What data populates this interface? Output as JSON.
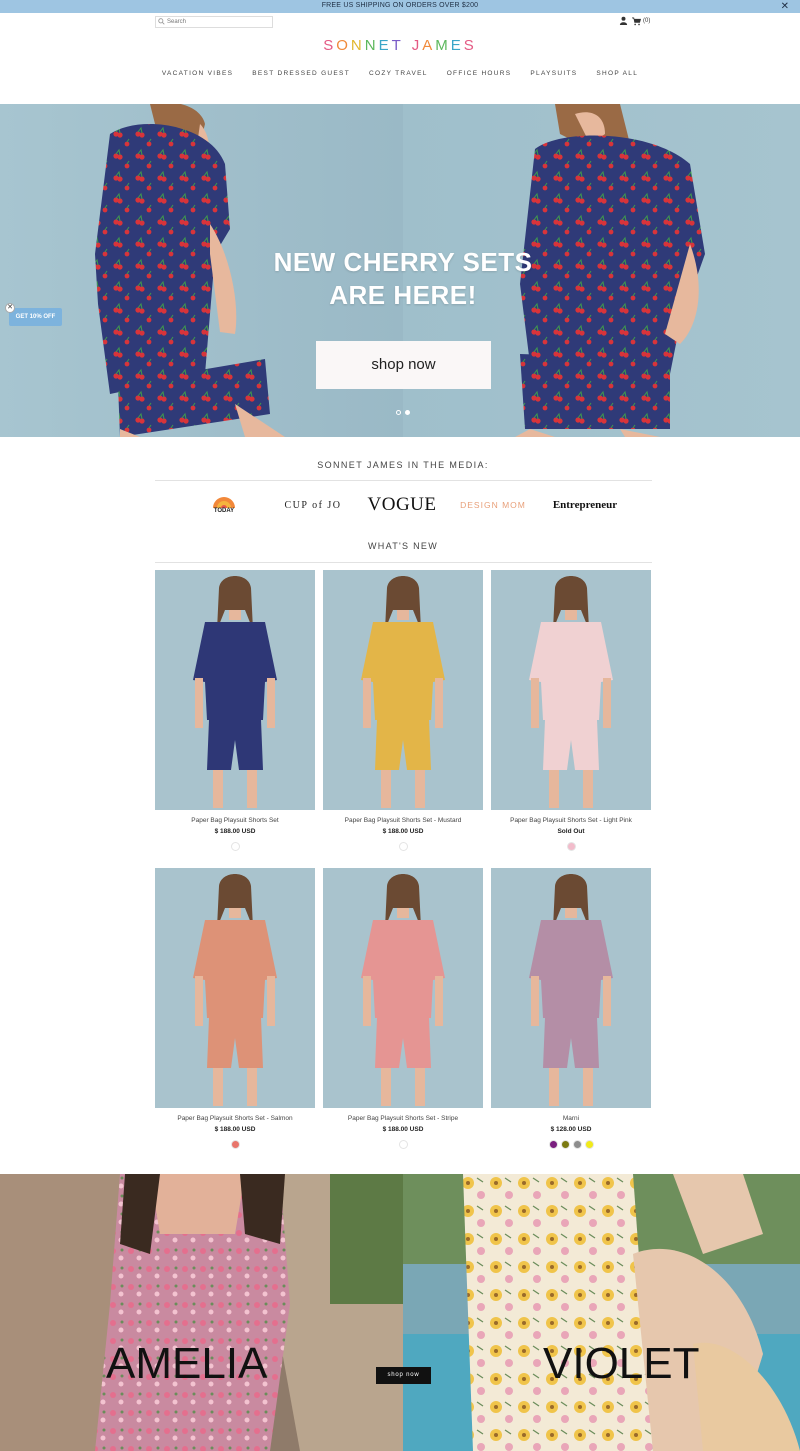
{
  "announcement": {
    "text": "FREE US SHIPPING ON ORDERS OVER $200",
    "close": "✕"
  },
  "header": {
    "search_placeholder": "Search",
    "cart_count": "(0)",
    "logo_letters": [
      {
        "ch": "S",
        "color": "#e45a84"
      },
      {
        "ch": "O",
        "color": "#f08a3a"
      },
      {
        "ch": "N",
        "color": "#e2b82e"
      },
      {
        "ch": "N",
        "color": "#5cb85c"
      },
      {
        "ch": "E",
        "color": "#3aa6c8"
      },
      {
        "ch": "T",
        "color": "#7a5cc8"
      },
      {
        "ch": " ",
        "color": "#ffffff"
      },
      {
        "ch": "J",
        "color": "#e45a84"
      },
      {
        "ch": "A",
        "color": "#f08a3a"
      },
      {
        "ch": "M",
        "color": "#5cb85c"
      },
      {
        "ch": "E",
        "color": "#3aa6c8"
      },
      {
        "ch": "S",
        "color": "#e45a84"
      }
    ],
    "nav": [
      "VACATION VIBES",
      "BEST DRESSED GUEST",
      "COZY TRAVEL",
      "OFFICE HOURS",
      "PLAYSUITS",
      "SHOP ALL"
    ]
  },
  "hero": {
    "headline_line1": "NEW CHERRY SETS",
    "headline_line2": "ARE HERE!",
    "cta": "shop now",
    "colors": {
      "set": "#2f3a78",
      "cherry": "#d8343a",
      "leaf": "#3f9a4c",
      "skin": "#e7b89d",
      "hair": "#9a6a45"
    }
  },
  "promo": {
    "label": "GET 10% OFF",
    "close": "✕"
  },
  "media": {
    "title": "SONNET JAMES IN THE MEDIA:",
    "logos": {
      "today": "TODAY",
      "cupofjo": "CUP of JO",
      "vogue": "VOGUE",
      "designmom": "DESIGN MOM",
      "entrepreneur": "Entrepreneur"
    }
  },
  "whats_new": {
    "title": "WHAT'S NEW",
    "products": [
      {
        "name": "Paper Bag Playsuit Shorts Set",
        "price": "$ 188.00 USD",
        "swatches": [
          "#ffffff"
        ],
        "outfit": "#2e3776"
      },
      {
        "name": "Paper Bag Playsuit Shorts Set - Mustard",
        "price": "$ 188.00 USD",
        "swatches": [
          "#ffffff"
        ],
        "outfit": "#e3b548"
      },
      {
        "name": "Paper Bag Playsuit Shorts Set - Light Pink",
        "price": "Sold Out",
        "swatches": [
          "#f2bccb"
        ],
        "outfit": "#f0d1d2"
      },
      {
        "name": "Paper Bag Playsuit Shorts Set - Salmon",
        "price": "$ 188.00 USD",
        "swatches": [
          "#e8756b"
        ],
        "outfit": "#dd9277"
      },
      {
        "name": "Paper Bag Playsuit Shorts Set - Stripe",
        "price": "$ 188.00 USD",
        "swatches": [
          "#ffffff"
        ],
        "outfit": "#e59593"
      },
      {
        "name": "Marni",
        "price": "$ 128.00 USD",
        "swatches": [
          "#7a1f7f",
          "#7b7a12",
          "#8d8d8d",
          "#f1ea1a"
        ],
        "outfit": "#b48ea6"
      }
    ]
  },
  "banners": {
    "left_word": "AMELIA",
    "right_word": "VIOLET",
    "cta": "shop now"
  }
}
